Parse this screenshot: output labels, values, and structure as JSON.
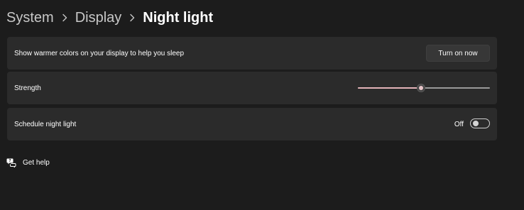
{
  "breadcrumb": {
    "items": [
      "System",
      "Display"
    ],
    "current": "Night light"
  },
  "night_light": {
    "description": "Show warmer colors on your display to help you sleep",
    "turn_on_label": "Turn on now"
  },
  "strength": {
    "label": "Strength",
    "value_fraction": 0.48
  },
  "schedule": {
    "label": "Schedule night light",
    "state_text": "Off",
    "enabled": false
  },
  "help": {
    "label": "Get help",
    "icon": "get-help-icon"
  },
  "colors": {
    "background": "#1c1c1c",
    "card": "#2b2b2b",
    "accent": "#e3b3b8"
  }
}
